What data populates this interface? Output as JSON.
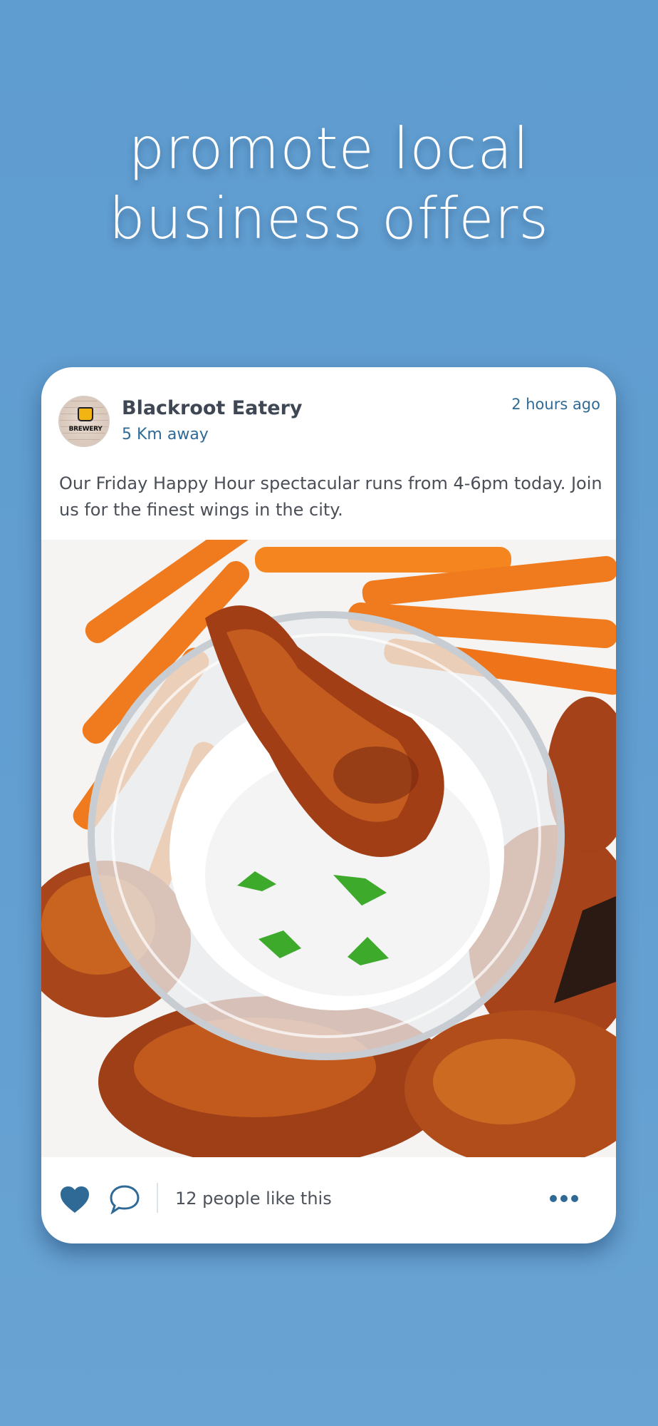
{
  "headline": {
    "line1": "promote local",
    "line2": "business offers"
  },
  "post": {
    "business_name": "Blackroot Eatery",
    "distance": "5 Km away",
    "time_ago": "2 hours ago",
    "avatar_text": "BREWERY",
    "text": "Our Friday Happy Hour spectacular runs from 4-6pm today. Join us for the finest wings in the city.",
    "image_description_icon": "food-photo-wings-with-dip"
  },
  "actions": {
    "likes_text": "12 people like this",
    "like_icon": "heart-icon",
    "comment_icon": "comment-icon",
    "more_icon": "more-dots-icon"
  },
  "colors": {
    "background": "#639fd1",
    "accent": "#2f6a96",
    "card": "#ffffff"
  }
}
